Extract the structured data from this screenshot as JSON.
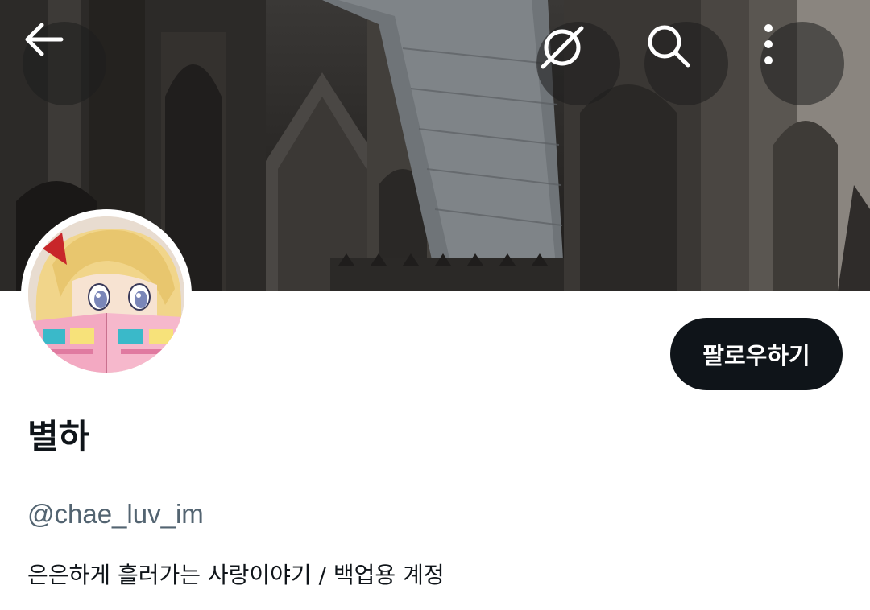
{
  "header": {
    "back_icon": "arrow-left-icon",
    "grok_icon": "grok-icon",
    "search_icon": "search-icon",
    "more_icon": "more-vertical-icon"
  },
  "profile": {
    "display_name": "별하",
    "handle": "@chae_luv_im",
    "bio": "은은하게 흘러가는 사랑이야기 / 백업용 계정",
    "follow_label": "팔로우하기"
  },
  "colors": {
    "follow_button_bg": "#0f1419",
    "follow_button_text": "#ffffff",
    "handle_text": "#536471",
    "primary_text": "#0f1419"
  }
}
